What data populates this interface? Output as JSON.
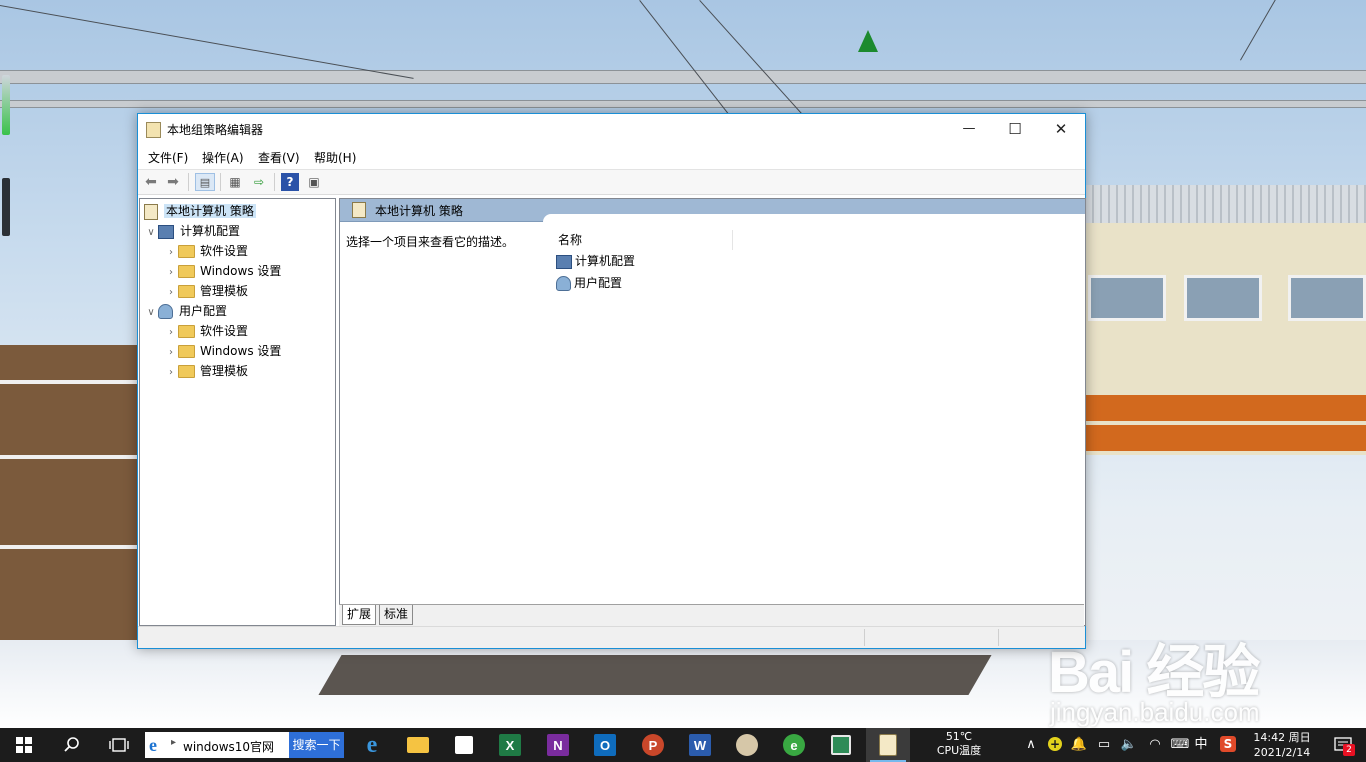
{
  "window": {
    "title": "本地组策略编辑器",
    "controls": {
      "minimize": "—",
      "maximize": "☐",
      "close": "✕"
    }
  },
  "menu": [
    "文件(F)",
    "操作(A)",
    "查看(V)",
    "帮助(H)"
  ],
  "toolbar": {
    "icons": [
      "back-arrow-icon",
      "forward-arrow-icon",
      "show-hide-tree-icon",
      "properties-icon",
      "export-list-icon",
      "help-icon",
      "show-action-pane-icon"
    ]
  },
  "tree": {
    "root": "本地计算机 策略",
    "computer_config": "计算机配置",
    "computer_children": [
      "软件设置",
      "Windows 设置",
      "管理模板"
    ],
    "user_config": "用户配置",
    "user_children": [
      "软件设置",
      "Windows 设置",
      "管理模板"
    ]
  },
  "details": {
    "header": "本地计算机 策略",
    "description": "选择一个项目来查看它的描述。",
    "column_name": "名称",
    "items": [
      "计算机配置",
      "用户配置"
    ]
  },
  "bottom_tabs": [
    "扩展",
    "标准"
  ],
  "taskbar": {
    "search_text": "windows10官网",
    "search_button": "搜索一下",
    "cpu_temp": "51℃",
    "cpu_label": "CPU温度",
    "ime": "中",
    "time": "14:42 周日",
    "date": "2021/2/14",
    "notification_count": "2"
  },
  "watermark": {
    "logo": "Bai  经验",
    "url": "jingyan.baidu.com"
  },
  "colors": {
    "accent": "#1a8fd6",
    "header_bar": "#9fb8d4",
    "selection": "#cce4f7",
    "taskbar": "#1c1c1c"
  }
}
